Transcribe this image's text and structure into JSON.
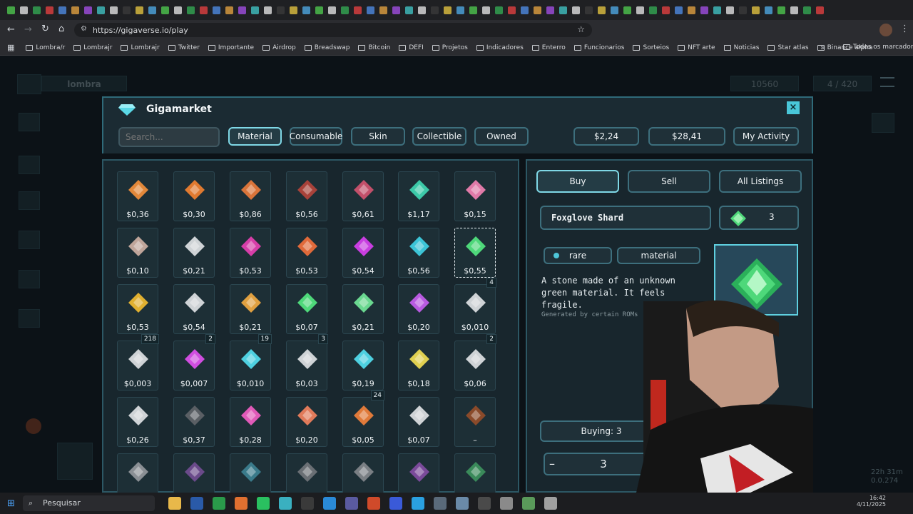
{
  "browser": {
    "url": "https://gigaverse.io/play",
    "bookmarks": [
      "Lombra/r",
      "Lombrajr",
      "Lombrajr",
      "Twitter",
      "Importante",
      "Airdrop",
      "Breadswap",
      "Bitcoin",
      "DEFI",
      "Projetos",
      "Indicadores",
      "Enterro",
      "Funcionarios",
      "Sorteios",
      "NFT arte",
      "Noticias",
      "Star atlas",
      "Binance alpha"
    ],
    "all_bookmarks": "Todos os marcadores"
  },
  "hud": {
    "player_name": "lombra",
    "gold": "10560",
    "energy": "4 / 420",
    "timer": "22h 31m",
    "rate": "0.0.274"
  },
  "market": {
    "title": "Gigamarket",
    "search_placeholder": "Search...",
    "tabs": [
      "Material",
      "Consumable",
      "Skin",
      "Collectible",
      "Owned"
    ],
    "active_tab": "Material",
    "balance1": "$2,24",
    "balance2": "$28,41",
    "my_activity": "My Activity",
    "close_icon": "close-icon"
  },
  "items": [
    {
      "price": "$0,36",
      "color": "#e2883a"
    },
    {
      "price": "$0,30",
      "color": "#e07a30"
    },
    {
      "price": "$0,86",
      "color": "#d9743a"
    },
    {
      "price": "$0,56",
      "color": "#a8423a"
    },
    {
      "price": "$0,61",
      "color": "#c2506a"
    },
    {
      "price": "$1,17",
      "color": "#3cc9a8"
    },
    {
      "price": "$0,15",
      "color": "#e07aa8"
    },
    {
      "price": "$0,10",
      "color": "#bfa59a"
    },
    {
      "price": "$0,21",
      "color": "#cfd3d6"
    },
    {
      "price": "$0,53",
      "color": "#d63ea8"
    },
    {
      "price": "$0,53",
      "color": "#e06a3a"
    },
    {
      "price": "$0,54",
      "color": "#c83ee0"
    },
    {
      "price": "$0,56",
      "color": "#3cc4d6"
    },
    {
      "price": "$0,55",
      "color": "#4ed87a"
    },
    {
      "price": "$0,53",
      "color": "#e0b030"
    },
    {
      "price": "$0,54",
      "color": "#cfd3d6"
    },
    {
      "price": "$0,21",
      "color": "#e0a040"
    },
    {
      "price": "$0,07",
      "color": "#4ed87a"
    },
    {
      "price": "$0,21",
      "color": "#6ad890"
    },
    {
      "price": "$0,20",
      "color": "#b85ae0"
    },
    {
      "price": "$0,010",
      "color": "#cfd3d6",
      "count": "4"
    },
    {
      "price": "$0,003",
      "color": "#cfd3d6",
      "count": "218"
    },
    {
      "price": "$0,007",
      "color": "#d04ee0",
      "count": "2"
    },
    {
      "price": "$0,010",
      "color": "#4ed0e0",
      "count": "19"
    },
    {
      "price": "$0,03",
      "color": "#cfd3d6",
      "count": "3"
    },
    {
      "price": "$0,19",
      "color": "#4ed0e0"
    },
    {
      "price": "$0,18",
      "color": "#e0d050"
    },
    {
      "price": "$0,06",
      "color": "#cfd3d6",
      "count": "2"
    },
    {
      "price": "$0,26",
      "color": "#cfd3d6"
    },
    {
      "price": "$0,37",
      "color": "#5a5f64"
    },
    {
      "price": "$0,28",
      "color": "#e05ab8"
    },
    {
      "price": "$0,20",
      "color": "#e07a5a"
    },
    {
      "price": "$0,05",
      "color": "#e07a3a",
      "count": "24"
    },
    {
      "price": "$0,07",
      "color": "#cfd3d6"
    },
    {
      "price": "–",
      "color": "#8a4a2a"
    },
    {
      "price": "",
      "color": "#8a8f94"
    },
    {
      "price": "",
      "color": "#6a4a8a"
    },
    {
      "price": "",
      "color": "#3a7a8a"
    },
    {
      "price": "",
      "color": "#6a6f74"
    },
    {
      "price": "",
      "color": "#7a7f84"
    },
    {
      "price": "",
      "color": "#7a4a9a"
    },
    {
      "price": "",
      "color": "#3a8a5a"
    }
  ],
  "detail": {
    "buy": "Buy",
    "sell": "Sell",
    "all_listings": "All Listings",
    "item_name": "Foxglove Shard",
    "owned_count": "3",
    "rarity": "rare",
    "type": "material",
    "description": "A stone made of an unknown green material. It feels fragile.",
    "generated": "Generated by certain ROMs",
    "buying": "Buying: 3",
    "qty_minus": "–",
    "qty": "3"
  },
  "taskbar": {
    "search": "Pesquisar",
    "time": "16:42",
    "date": "4/11/2025"
  }
}
